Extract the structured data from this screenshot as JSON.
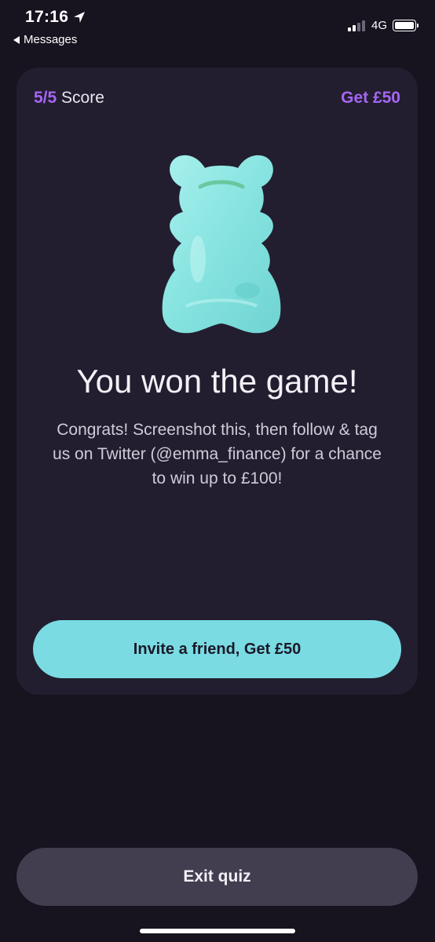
{
  "status_bar": {
    "time": "17:16",
    "back_label": "Messages",
    "network": "4G",
    "signal_bars_active": 2,
    "signal_bars_total": 4,
    "icons": [
      "location-arrow-icon",
      "back-arrow-icon",
      "signal-icon",
      "battery-icon"
    ]
  },
  "card": {
    "score_value": "5/5",
    "score_label": "Score",
    "reward_label": "Get £50",
    "illustration": "gummy-bear-icon",
    "headline": "You won the game!",
    "message": "Congrats! Screenshot this, then follow & tag us on Twitter (@emma_finance) for a chance to win up to  £100!",
    "invite_button_label": "Invite a friend, Get £50"
  },
  "footer": {
    "exit_button_label": "Exit quiz"
  },
  "colors": {
    "background": "#17131f",
    "card": "#221e2f",
    "accent_purple": "#a566f2",
    "accent_teal": "#7adbe3",
    "exit_button": "#423e50",
    "bear": "#8ee5e2"
  }
}
